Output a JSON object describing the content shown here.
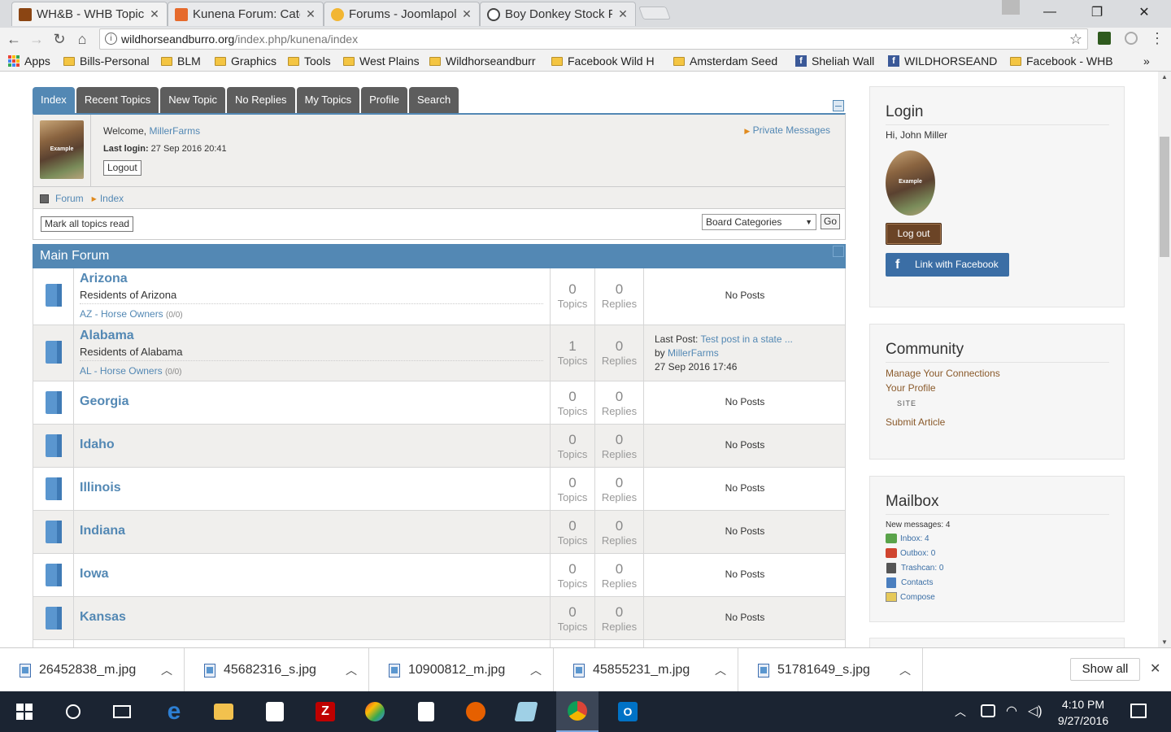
{
  "browser": {
    "tabs": [
      {
        "title": "WH&B - WHB Topic",
        "icon_color": "#8b4513",
        "icon": "whb-favicon"
      },
      {
        "title": "Kunena Forum: Cate",
        "icon_color": "#e66a2c",
        "icon": "joomla-favicon"
      },
      {
        "title": "Forums - Joomlapol",
        "icon_color": "#f2b632",
        "icon": "joomlapolis-favicon"
      },
      {
        "title": "Boy Donkey Stock P",
        "icon_color": "#444444",
        "icon": "stock-photo-favicon"
      }
    ],
    "url_host": "wildhorseandburro.org",
    "url_path": "/index.php/kunena/index",
    "bookmarks": [
      {
        "label": "Apps",
        "type": "apps"
      },
      {
        "label": "Bills-Personal",
        "type": "folder"
      },
      {
        "label": "BLM",
        "type": "folder"
      },
      {
        "label": "Graphics",
        "type": "folder"
      },
      {
        "label": "Tools",
        "type": "folder"
      },
      {
        "label": "West Plains",
        "type": "folder"
      },
      {
        "label": "Wildhorseandburr",
        "type": "folder"
      },
      {
        "label": "Facebook Wild H",
        "type": "folder"
      },
      {
        "label": "Amsterdam Seed",
        "type": "folder"
      },
      {
        "label": "Sheliah Wall",
        "type": "facebook"
      },
      {
        "label": "WILDHORSEAND",
        "type": "facebook"
      },
      {
        "label": "Facebook - WHB",
        "type": "folder"
      }
    ],
    "more_bookmarks": "»"
  },
  "forum": {
    "menu": [
      "Index",
      "Recent Topics",
      "New Topic",
      "No Replies",
      "My Topics",
      "Profile",
      "Search"
    ],
    "welcome_label": "Welcome,",
    "username": "MillerFarms",
    "last_login_label": "Last login:",
    "last_login": "27 Sep 2016 20:41",
    "logout": "Logout",
    "private_messages": "Private Messages",
    "breadcrumb": [
      "Forum",
      "Index"
    ],
    "mark_all_read": "Mark all topics read",
    "board_select": "Board Categories",
    "go": "Go",
    "section_title": "Main Forum",
    "topics_label": "Topics",
    "replies_label": "Replies",
    "categories": [
      {
        "name": "Arizona",
        "desc": "Residents of Arizona",
        "sub": "AZ - Horse Owners",
        "sub_count": "(0/0)",
        "topics": "0",
        "replies": "0",
        "last": "No Posts"
      },
      {
        "name": "Alabama",
        "desc": "Residents of Alabama",
        "sub": "AL - Horse Owners",
        "sub_count": "(0/0)",
        "topics": "1",
        "replies": "0",
        "last_post_label": "Last Post:",
        "last_post_title": "Test post in a state ...",
        "by_label": "by",
        "last_post_author": "MillerFarms",
        "last_post_date": "27 Sep 2016 17:46"
      },
      {
        "name": "Georgia",
        "topics": "0",
        "replies": "0",
        "last": "No Posts"
      },
      {
        "name": "Idaho",
        "topics": "0",
        "replies": "0",
        "last": "No Posts"
      },
      {
        "name": "Illinois",
        "topics": "0",
        "replies": "0",
        "last": "No Posts"
      },
      {
        "name": "Indiana",
        "topics": "0",
        "replies": "0",
        "last": "No Posts"
      },
      {
        "name": "Iowa",
        "topics": "0",
        "replies": "0",
        "last": "No Posts"
      },
      {
        "name": "Kansas",
        "topics": "0",
        "replies": "0",
        "last": "No Posts"
      }
    ]
  },
  "sidebar": {
    "login": {
      "title": "Login",
      "greeting": "Hi, John Miller",
      "logout": "Log out",
      "facebook": "Link with Facebook"
    },
    "community": {
      "title": "Community",
      "links": [
        "Manage Your Connections",
        "Your Profile"
      ],
      "site_label": "SITE",
      "submit": "Submit Article"
    },
    "mailbox": {
      "title": "Mailbox",
      "new_messages": "New messages: 4",
      "items": [
        "Inbox: 4",
        "Outbox: 0",
        "Trashcan: 0",
        "Contacts",
        "Compose"
      ]
    }
  },
  "downloads": {
    "files": [
      "26452838_m.jpg",
      "45682316_s.jpg",
      "10900812_m.jpg",
      "45855231_m.jpg",
      "51781649_s.jpg"
    ],
    "show_all": "Show all"
  },
  "taskbar": {
    "time": "4:10 PM",
    "date": "9/27/2016"
  },
  "colors": {
    "accent": "#5388b4",
    "tab_dark": "#5d5d5d",
    "logout_btn": "#6b4426",
    "facebook": "#3b6ea5",
    "taskbar": "#1b2432"
  }
}
